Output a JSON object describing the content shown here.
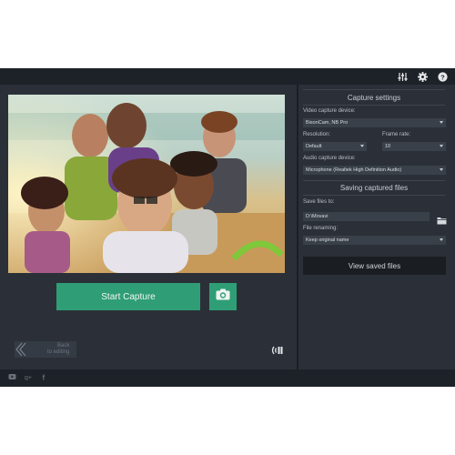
{
  "main": {
    "start_capture_label": "Start Capture",
    "back_label_line1": "Back",
    "back_label_line2": "to editing"
  },
  "settings": {
    "capture_title": "Capture settings",
    "video_device_label": "Video capture device:",
    "video_device_value": "BisonCam, NB Pro",
    "resolution_label": "Resolution:",
    "resolution_value": "Default",
    "frame_rate_label": "Frame rate:",
    "frame_rate_value": "10",
    "audio_device_label": "Audio capture device:",
    "audio_device_value": "Microphone (Realtek High Definition Audio)",
    "saving_title": "Saving captured files",
    "save_to_label": "Save files to:",
    "save_to_value": "D:\\Movavi",
    "renaming_label": "File renaming:",
    "renaming_value": "Keep original name",
    "view_saved_label": "View saved files"
  },
  "icons": {
    "titlebar": [
      "equalizer-icon",
      "gear-icon",
      "help-icon"
    ],
    "statusbar": [
      "youtube-icon",
      "google-plus-icon",
      "facebook-icon"
    ]
  },
  "colors": {
    "accent": "#2f9e77",
    "panel": "#2b3038",
    "bar": "#1d2228"
  }
}
